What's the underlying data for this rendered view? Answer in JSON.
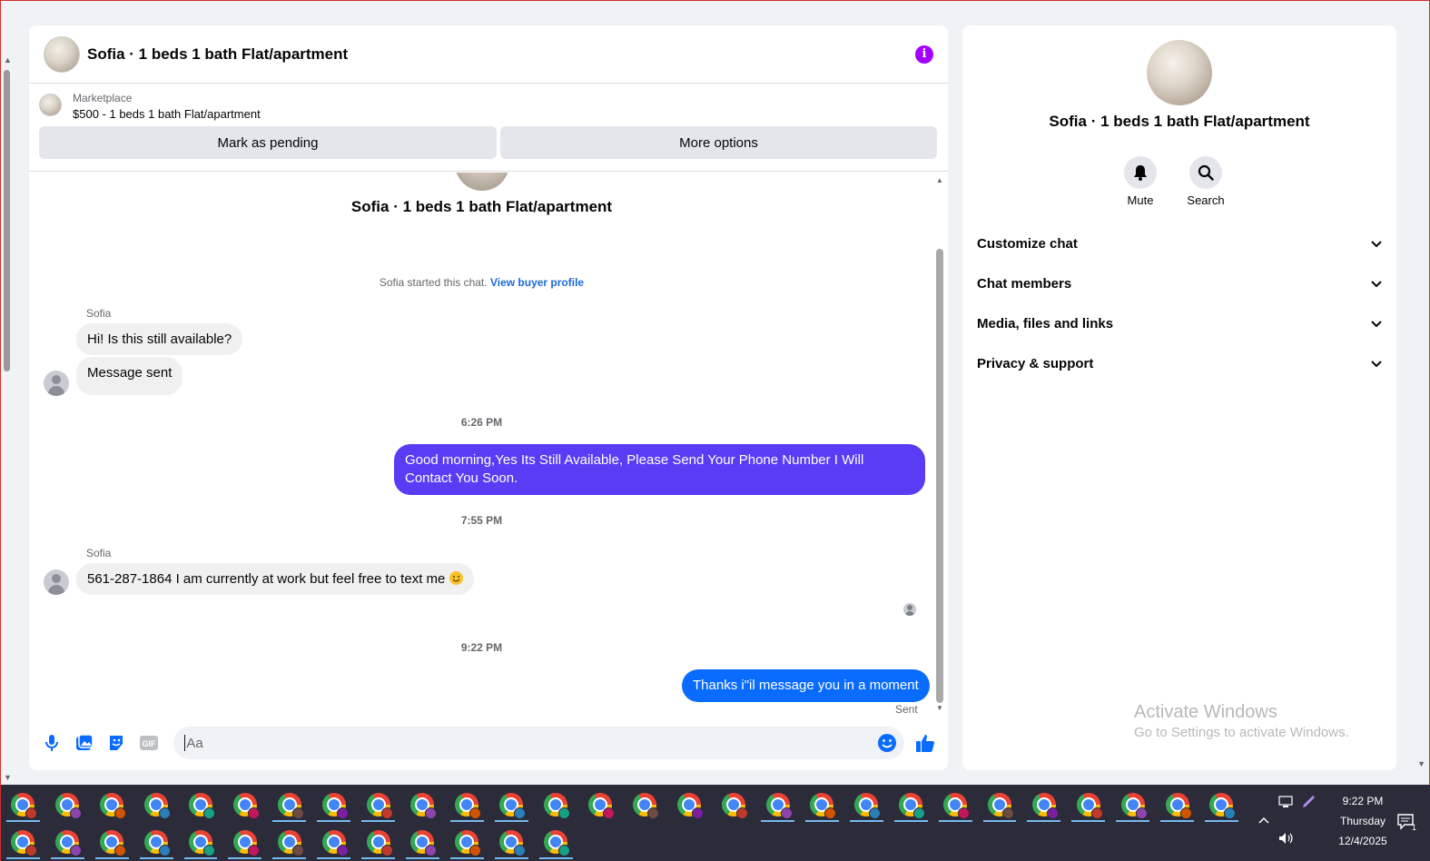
{
  "chat": {
    "header_title": "Sofia · 1 beds 1 bath Flat/apartment",
    "marketplace_label": "Marketplace",
    "listing": "$500 - 1 beds 1 bath Flat/apartment",
    "mark_pending_label": "Mark as pending",
    "more_options_label": "More options",
    "conversation_title": "Sofia · 1 beds 1 bath Flat/apartment",
    "started_text": "Sofia started this chat.",
    "view_profile_link": "View buyer profile",
    "messages": [
      {
        "sender": "Sofia",
        "text": "Hi! Is this still available?"
      },
      {
        "text": "Message sent"
      },
      {
        "time": "6:26 PM"
      },
      {
        "text": "Good morning,Yes Its Still Available, Please Send Your Phone Number I Will Contact You Soon.",
        "outgoing": true
      },
      {
        "time": "7:55 PM"
      },
      {
        "sender": "Sofia",
        "text": "561-287-1864 I am currently at work but feel free to text me"
      },
      {
        "time": "9:22 PM"
      },
      {
        "text": "Thanks i\"il message you in a moment",
        "outgoing": true,
        "status": "Sent"
      }
    ],
    "composer_placeholder": "Aa"
  },
  "info": {
    "title": "Sofia · 1 beds 1 bath Flat/apartment",
    "mute_label": "Mute",
    "search_label": "Search",
    "sections": [
      "Customize chat",
      "Chat members",
      "Media, files and links",
      "Privacy & support"
    ]
  },
  "watermark": {
    "line1": "Activate Windows",
    "line2": "Go to Settings to activate Windows."
  },
  "taskbar": {
    "time": "9:22 PM",
    "day": "Thursday",
    "date": "12/4/2025",
    "notification_count": "1"
  },
  "colors": {
    "outgoing_purple": "#5b3cf5",
    "outgoing_blue": "#0a6cff",
    "info_icon": "#a200ff",
    "link": "#1c6ad6",
    "taskbar_bg": "#2b2b3a"
  }
}
